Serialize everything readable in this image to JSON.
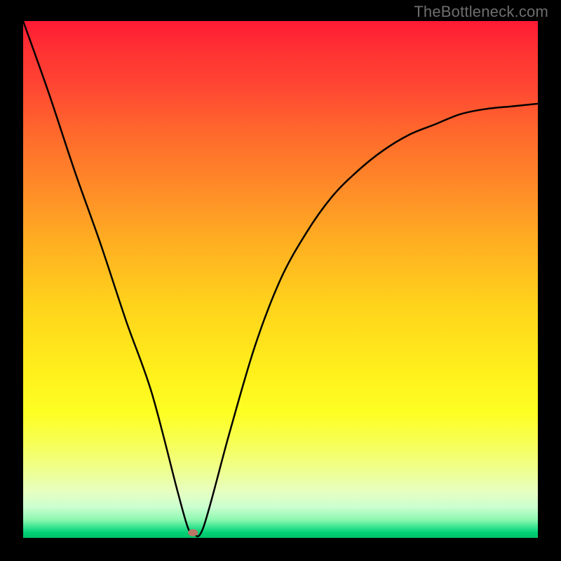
{
  "watermark": "TheBottleneck.com",
  "chart_data": {
    "type": "line",
    "title": "",
    "xlabel": "",
    "ylabel": "",
    "xlim": [
      0,
      1
    ],
    "ylim": [
      0,
      1
    ],
    "x": [
      0.0,
      0.05,
      0.1,
      0.15,
      0.2,
      0.25,
      0.3,
      0.32,
      0.33,
      0.35,
      0.4,
      0.45,
      0.5,
      0.55,
      0.6,
      0.65,
      0.7,
      0.75,
      0.8,
      0.85,
      0.9,
      0.95,
      1.0
    ],
    "values": [
      1.0,
      0.86,
      0.71,
      0.57,
      0.42,
      0.28,
      0.09,
      0.02,
      0.01,
      0.02,
      0.2,
      0.37,
      0.5,
      0.59,
      0.66,
      0.71,
      0.75,
      0.78,
      0.8,
      0.82,
      0.83,
      0.835,
      0.84
    ],
    "minimum": {
      "x": 0.33,
      "y": 0.01
    },
    "background_gradient": {
      "top": "#ff1a33",
      "mid": "#fff01c",
      "bottom": "#00c268"
    }
  }
}
